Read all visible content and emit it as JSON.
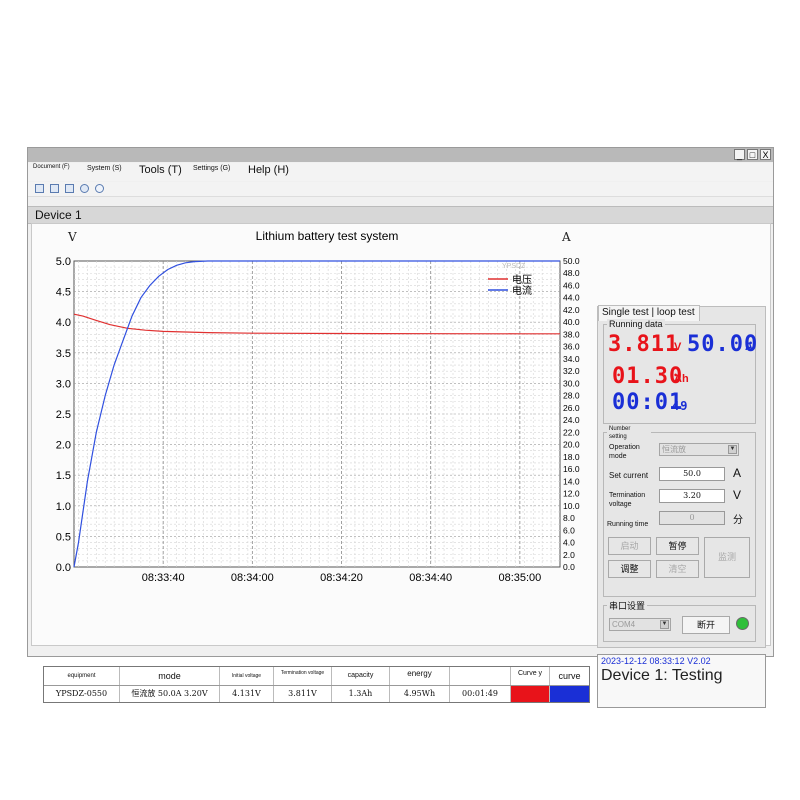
{
  "menu": {
    "document": "Document (F)",
    "system": "System (S)",
    "tools": "Tools (T)",
    "settings": "Settings (G)",
    "help": "Help (H)"
  },
  "window_buttons": {
    "minimize": "_",
    "maximize": "□",
    "close": "X"
  },
  "toolbar_icons": [
    "new-file-icon",
    "save-icon",
    "print-icon",
    "wrench-icon",
    "chat-icon"
  ],
  "tab": {
    "label": "Device 1"
  },
  "chart_data": {
    "type": "line",
    "title": "Lithium battery test system",
    "left_axis_label": "V",
    "right_axis_label": "A",
    "watermark": "YPSDZ",
    "x_ticks": [
      "08:33:40",
      "08:34:00",
      "08:34:20",
      "08:34:40",
      "08:35:00"
    ],
    "xlim_seconds": [
      0,
      109
    ],
    "y_left_ticks": [
      "0.0",
      "0.5",
      "1.0",
      "1.5",
      "2.0",
      "2.5",
      "3.0",
      "3.5",
      "4.0",
      "4.5",
      "5.0"
    ],
    "y_left_lim": [
      0,
      5
    ],
    "y_right_ticks": [
      "0.0",
      "2.0",
      "4.0",
      "6.0",
      "8.0",
      "10.0",
      "12.0",
      "14.0",
      "16.0",
      "18.0",
      "20.0",
      "22.0",
      "24.0",
      "26.0",
      "28.0",
      "30.0",
      "32.0",
      "34.0",
      "36.0",
      "38.0",
      "40.0",
      "42.0",
      "44.0",
      "46.0",
      "48.0",
      "50.0"
    ],
    "y_right_lim": [
      0,
      50
    ],
    "grid": true,
    "legend_position": "top-right",
    "series": [
      {
        "name": "电压",
        "axis": "left",
        "color": "#e03030",
        "x": [
          0,
          2,
          5,
          8,
          12,
          16,
          20,
          25,
          30,
          40,
          60,
          80,
          100,
          109
        ],
        "y": [
          4.131,
          4.1,
          4.03,
          3.96,
          3.9,
          3.87,
          3.85,
          3.84,
          3.83,
          3.82,
          3.815,
          3.812,
          3.811,
          3.811
        ]
      },
      {
        "name": "电流",
        "axis": "right",
        "color": "#3050e0",
        "x": [
          0,
          1,
          3,
          5,
          7,
          9,
          11,
          13,
          15,
          17,
          19,
          21,
          23,
          25,
          27,
          30,
          109
        ],
        "y": [
          0,
          4,
          14,
          22,
          28,
          33,
          37,
          41,
          44,
          46,
          47.5,
          48.6,
          49.3,
          49.7,
          49.9,
          50.0,
          50.0
        ]
      }
    ]
  },
  "right_panel": {
    "tab_label": "Single test | loop test",
    "running_data_label": "Running data",
    "voltage": "3.811",
    "voltage_unit": "V",
    "current": "50.00",
    "current_unit": "A",
    "capacity": "01.30",
    "capacity_unit": "Ah",
    "time": "00:01",
    "time_seconds": "49",
    "number_setting_label": "Number setting",
    "operation_mode_label": "Operation mode",
    "operation_mode_value": "恒流放",
    "set_current_label": "Set current",
    "set_current_value": "50.0",
    "set_current_unit": "A",
    "termination_voltage_label": "Termination voltage",
    "termination_voltage_value": "3.20",
    "termination_voltage_unit": "V",
    "running_time_label": "Running time",
    "running_time_value": "0",
    "running_time_unit": "分",
    "btn_start": "启动",
    "btn_pause": "暂停",
    "btn_adjust": "调整",
    "btn_clear": "清空",
    "btn_monitor": "监测",
    "serial_label": "串口设置",
    "serial_port_value": "COM4",
    "btn_disconnect": "断开",
    "connection_color": "#2fbf3a"
  },
  "status": {
    "timestamp": "2023-12-12 08:33:12 V2.02",
    "message": "Device 1: Testing"
  },
  "table": {
    "headers": [
      "equipment",
      "mode",
      "Initial voltage",
      "Termination voltage",
      "capacity",
      "energy",
      "",
      "Curve y",
      "curve"
    ],
    "row": [
      "YPSDZ-0550",
      "恒流放 50.0A 3.20V",
      "4.131V",
      "3.811V",
      "1.3Ah",
      "4.95Wh",
      "00:01:49"
    ],
    "curve_colors": [
      "#e8131a",
      "#1a2fd6"
    ]
  }
}
